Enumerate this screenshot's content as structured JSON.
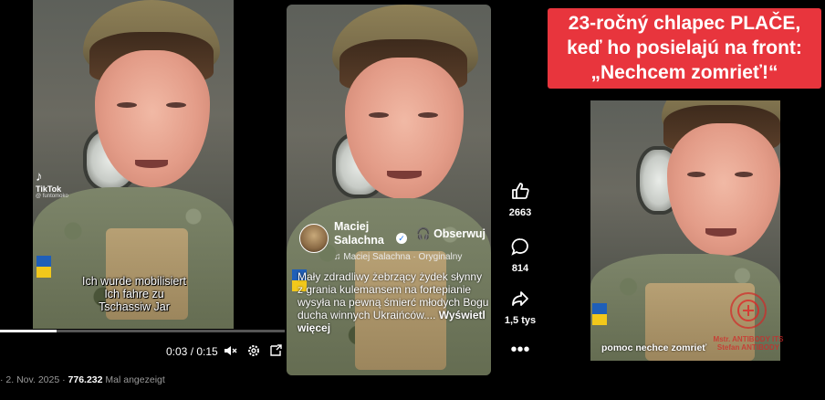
{
  "panel1": {
    "tiktok_name": "TikTok",
    "tiktok_handle": "@ funtomoko",
    "caption_line1": "Ich wurde mobilisiert",
    "caption_line2": "Ich fahre zu",
    "caption_line3": "Tschassiw Jar",
    "time_readout": "0:03 / 0:15",
    "progress": 0.2,
    "post_date": "· 2. Nov. 2025 ·",
    "post_views": "776.232",
    "post_views_label": "Mal angezeigt"
  },
  "panel2": {
    "author_line1": "Maciej",
    "author_line2": "Salachna",
    "follow_label": "Obserwuj",
    "audio_line": "Maciej Salachna · Oryginalny",
    "description": "Mały zdradliwy żebrzący żydek słynny z grania kulemansem na fortepianie wysyła na pewną śmierć młodych Bogu ducha winnych Ukraińców....",
    "more_label": "Wyświetl więcej"
  },
  "reactions": {
    "likes": "2663",
    "comments": "814",
    "shares": "1,5 tys"
  },
  "panel3": {
    "headline_line1": "23-ročný chlapec PLAČE,",
    "headline_line2": "keď ho posielajú na front:",
    "headline_line3": "„Nechcem zomrieť!“",
    "caption": "pomoc nechce zomrieť",
    "stamp_text": "Mstr. ANTIBODY ITS Stefan ANTIBODY"
  },
  "icons": {
    "like": "thumbs-up-icon",
    "comment": "comment-bubble-icon",
    "share": "share-arrow-icon",
    "more": "more-dots-icon",
    "volume": "mute-icon",
    "settings": "gear-icon",
    "pip": "picture-in-picture-icon"
  },
  "colors": {
    "headline_bg": "#e8353d",
    "flag_blue": "#1f5fb8",
    "flag_yellow": "#f2c81b"
  }
}
